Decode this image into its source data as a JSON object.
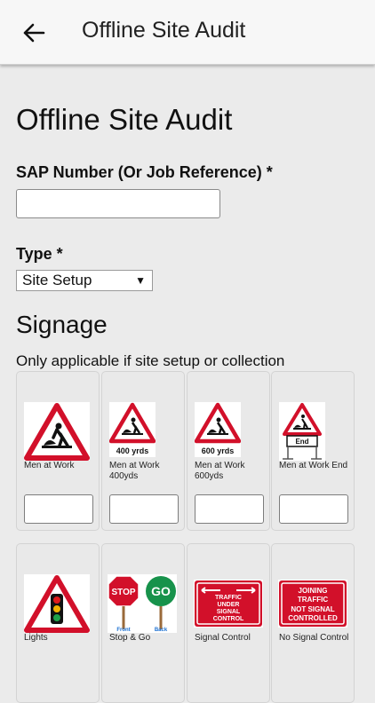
{
  "header": {
    "title": "Offline Site Audit",
    "back_icon": "arrow-left-icon"
  },
  "page": {
    "title": "Offline Site Audit"
  },
  "form": {
    "sap_label": "SAP Number (Or Job Reference) *",
    "sap_value": "",
    "type_label": "Type *",
    "type_value": "Site Setup"
  },
  "signage": {
    "title": "Signage",
    "subtitle": "Only applicable if site setup or collection",
    "items": [
      {
        "label": "Men at Work",
        "icon": "men-at-work-sign-icon",
        "quantity": ""
      },
      {
        "label": "Men at Work 400yds",
        "icon": "men-at-work-400yds-sign-icon",
        "quantity": "",
        "plate": "400 yrds"
      },
      {
        "label": "Men at Work 600yds",
        "icon": "men-at-work-600yds-sign-icon",
        "quantity": "",
        "plate": "600 yrds"
      },
      {
        "label": "Men at Work End",
        "icon": "men-at-work-end-sign-icon",
        "quantity": "",
        "plate": "End"
      },
      {
        "label": "Lights",
        "icon": "traffic-lights-sign-icon"
      },
      {
        "label": "Stop & Go",
        "icon": "stop-go-sign-icon",
        "stop": "STOP",
        "go": "GO",
        "front": "Front",
        "back": "Back"
      },
      {
        "label": "Signal Control",
        "icon": "signal-control-sign-icon",
        "sign_text": [
          "TRAFFIC",
          "UNDER",
          "SIGNAL",
          "CONTROL"
        ]
      },
      {
        "label": "No Signal Control",
        "icon": "no-signal-control-sign-icon",
        "sign_text": [
          "JOINING",
          "TRAFFIC",
          "NOT SIGNAL",
          "CONTROLLED"
        ]
      }
    ]
  },
  "colors": {
    "sign_red": "#d2102a",
    "background": "#ebebeb"
  }
}
